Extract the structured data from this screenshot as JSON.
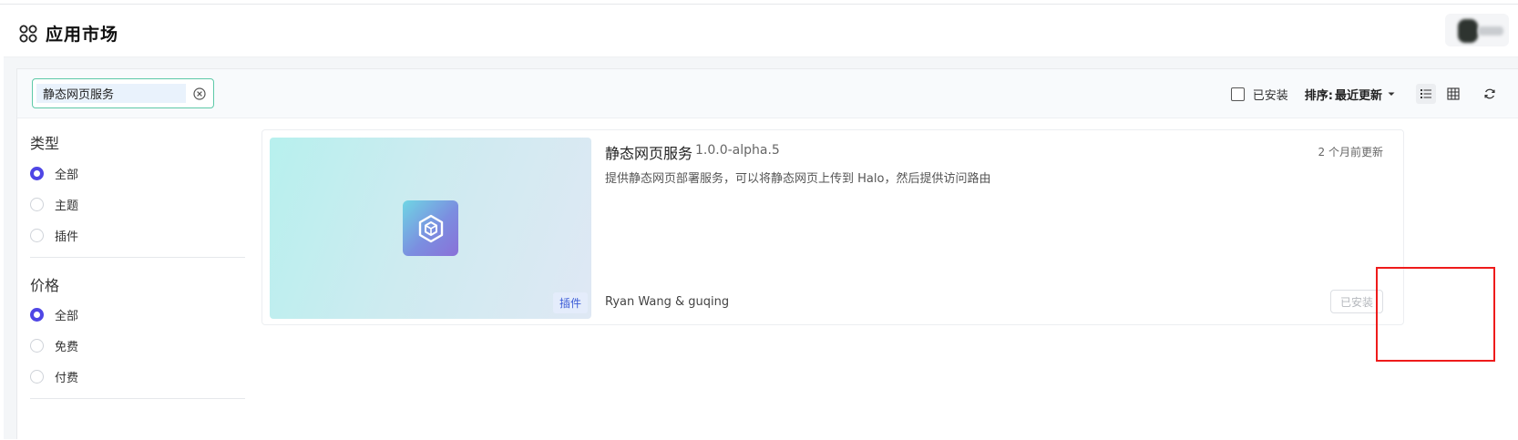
{
  "header": {
    "title": "应用市场",
    "app_icon": "apps-grid-icon"
  },
  "search": {
    "value": "静态网页服务",
    "clear_icon": "circle-x-icon"
  },
  "toolbar": {
    "installed_filter_label": "已安装",
    "sort_label": "排序:",
    "sort_value": "最近更新",
    "view_list_icon": "list-view-icon",
    "view_grid_icon": "grid-view-icon",
    "refresh_icon": "refresh-icon"
  },
  "filters": {
    "type": {
      "title": "类型",
      "options": [
        "全部",
        "主题",
        "插件"
      ],
      "selected": "全部"
    },
    "price": {
      "title": "价格",
      "options": [
        "全部",
        "免费",
        "付费"
      ],
      "selected": "全部"
    }
  },
  "plugin": {
    "name": "静态网页服务",
    "version": "1.0.0-alpha.5",
    "updated": "2 个月前更新",
    "description": "提供静态网页部署服务，可以将静态网页上传到 Halo，然后提供访问路由",
    "author": "Ryan Wang & guqing",
    "type_tag": "插件",
    "status_button": "已安装",
    "logo_icon": "cube-logo-icon"
  },
  "colors": {
    "accent": "#4f46e5",
    "search_border": "#5dc9a8",
    "highlight": "#ee1b1b",
    "tag_text": "#3b5bd6"
  }
}
